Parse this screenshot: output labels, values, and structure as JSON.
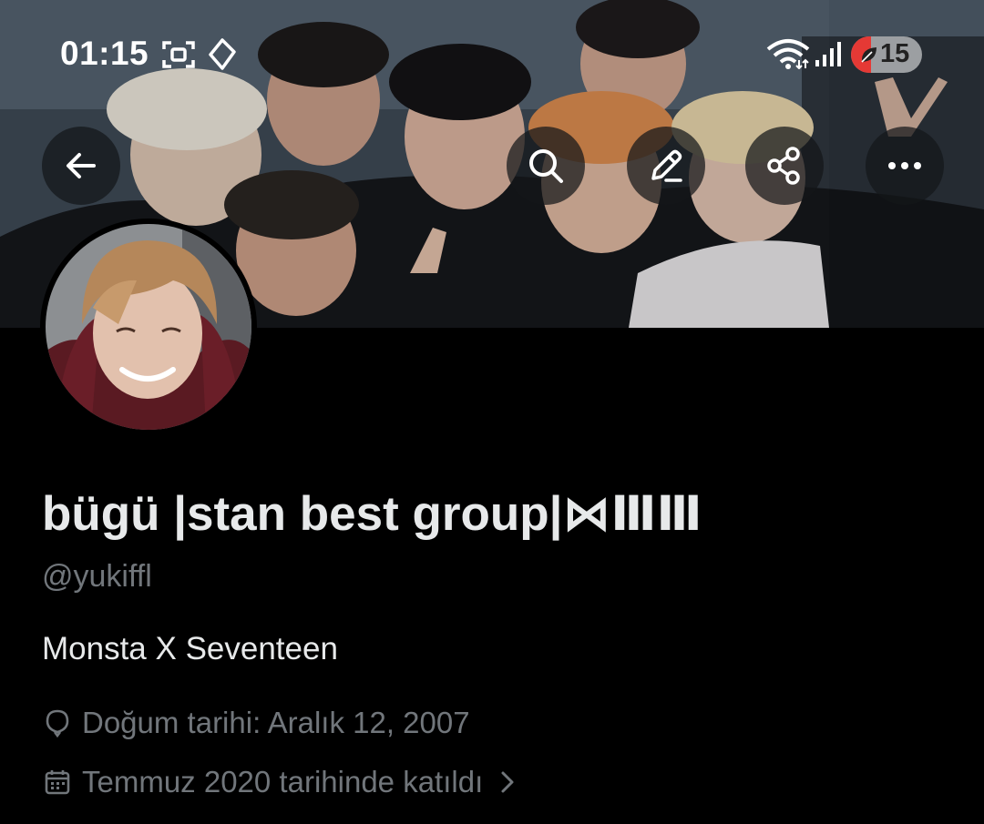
{
  "status_bar": {
    "time": "01:15",
    "battery_percent": "15",
    "icons": [
      "screenshot-icon",
      "tag-icon",
      "wifi-icon",
      "signal-icon",
      "battery-icon"
    ]
  },
  "header": {
    "back_icon": "arrow-left-icon",
    "actions": [
      "search-icon",
      "edit-icon",
      "share-icon",
      "more-icon"
    ]
  },
  "profile": {
    "display_name": "bügü |stan best group|⋈ⅢⅢ",
    "handle": "@yukiffl",
    "bio": "Monsta X Seventeen",
    "birthday": "Doğum tarihi: Aralık 12, 2007",
    "joined": "Temmuz 2020 tarihinde katıldı"
  },
  "colors": {
    "background": "#000000",
    "primary_text": "#e7e9ea",
    "secondary_text": "#71767b",
    "battery_low": "#e53935"
  }
}
